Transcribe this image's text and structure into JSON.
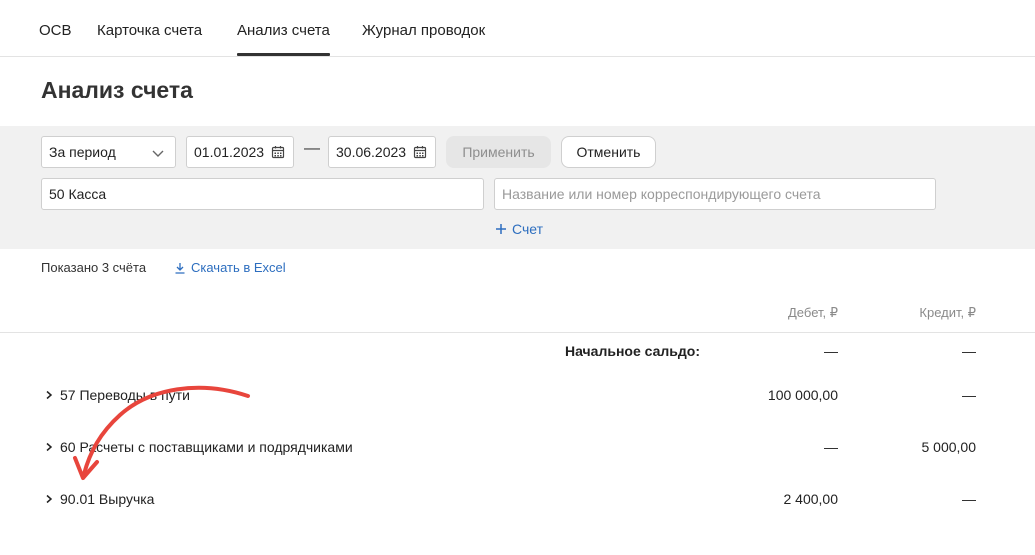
{
  "tabs": [
    {
      "label": "ОСВ",
      "active": false
    },
    {
      "label": "Карточка счета",
      "active": false
    },
    {
      "label": "Анализ счета",
      "active": true
    },
    {
      "label": "Журнал проводок",
      "active": false
    }
  ],
  "page_title": "Анализ счета",
  "filters": {
    "period_select": "За период",
    "date_from": "01.01.2023",
    "date_separator": "—",
    "date_to": "30.06.2023",
    "apply_label": "Применить",
    "cancel_label": "Отменить",
    "account_value": "50 Касса",
    "corr_account_placeholder": "Название или номер корреспондирующего счета",
    "add_account_label": "Счет"
  },
  "summary": {
    "shown_text": "Показано 3 счёта",
    "download_label": "Скачать в Excel"
  },
  "table": {
    "columns": {
      "debit": "Дебет, ₽",
      "credit": "Кредит, ₽"
    },
    "opening_balance": {
      "label": "Начальное сальдо:",
      "debit": "—",
      "credit": "—"
    },
    "rows": [
      {
        "label": "57 Переводы в пути",
        "debit": "100 000,00",
        "credit": "—"
      },
      {
        "label": "60 Расчеты с поставщиками и подрядчиками",
        "debit": "—",
        "credit": "5 000,00"
      },
      {
        "label": "90.01 Выручка",
        "debit": "2 400,00",
        "credit": "—"
      }
    ]
  },
  "colors": {
    "link": "#2d6ebf",
    "annotation_arrow": "#e8453c",
    "filter_panel": "#f1f1f1"
  }
}
